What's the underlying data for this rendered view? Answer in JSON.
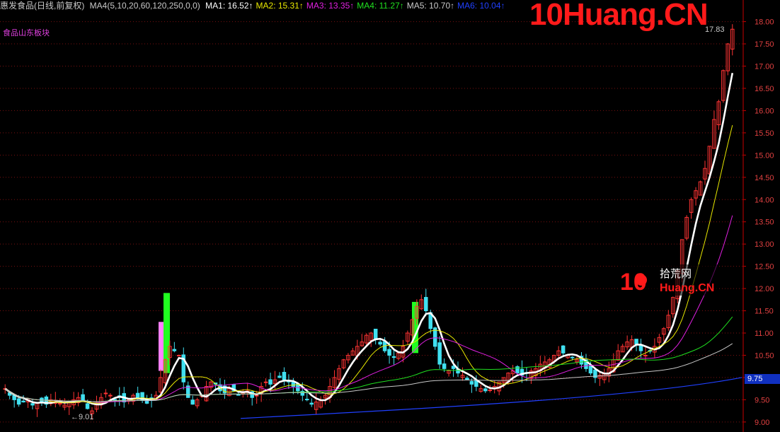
{
  "header": {
    "stock": "惠发食品(日线,前复权)",
    "indicator": "MA4(5,10,20,60,120,250,0,0)",
    "mas": [
      {
        "label": "MA1: 16.52↑",
        "color": "#ffffff"
      },
      {
        "label": "MA2: 15.31↑",
        "color": "#e8e800"
      },
      {
        "label": "MA3: 13.35↑",
        "color": "#e020e0"
      },
      {
        "label": "MA4: 11.27↑",
        "color": "#20e020"
      },
      {
        "label": "MA5: 10.70↑",
        "color": "#c8c8c8"
      },
      {
        "label": "MA6: 10.04↑",
        "color": "#2040ff"
      }
    ]
  },
  "sector_label": "食品山东板块",
  "watermark": {
    "main": "10Huang.CN",
    "logo_num": "10",
    "logo_cn": "拾荒网",
    "logo_sub": "Huang.CN"
  },
  "low_label": "←9.01",
  "high_label": "17.83",
  "current_price": "9.75",
  "colors": {
    "up": "#ff3333",
    "down": "#40e0f0",
    "grid": "#7a1010",
    "axis": "#c80000",
    "ma1": "#ffffff",
    "ma2": "#e8e800",
    "ma3": "#e020e0",
    "ma4": "#20e020",
    "ma5": "#c8c8c8",
    "ma6": "#2040ff",
    "vol_green": "#20ff20",
    "vol_pink": "#ff80ff"
  },
  "chart_data": {
    "type": "candlestick",
    "ylim": [
      8.95,
      18.2
    ],
    "yticks": [
      9.0,
      9.5,
      10.0,
      10.5,
      11.0,
      11.5,
      12.0,
      12.5,
      13.0,
      13.5,
      14.0,
      14.5,
      15.0,
      15.5,
      16.0,
      16.5,
      17.0,
      17.5,
      18.0
    ],
    "ytick_labels": [
      "9.00",
      "9.50",
      "10.00",
      "10.50",
      "11.00",
      "11.50",
      "12.00",
      "12.50",
      "13.00",
      "13.50",
      "14.00",
      "14.50",
      "15.00",
      "15.50",
      "16.00",
      "16.50",
      "17.00",
      "17.50",
      "18.00"
    ],
    "closes": [
      9.75,
      9.6,
      9.5,
      9.4,
      9.45,
      9.5,
      9.38,
      9.42,
      9.45,
      9.4,
      9.5,
      9.48,
      9.42,
      9.38,
      9.45,
      9.5,
      9.55,
      9.48,
      9.3,
      9.25,
      9.4,
      9.55,
      9.65,
      9.6,
      9.5,
      9.55,
      9.45,
      9.5,
      9.6,
      9.55,
      9.5,
      9.42,
      9.5,
      9.6,
      10.0,
      10.4,
      10.7,
      10.6,
      10.5,
      9.9,
      9.55,
      9.4,
      9.5,
      9.6,
      9.8,
      9.9,
      9.85,
      9.7,
      9.65,
      9.75,
      9.7,
      9.6,
      9.65,
      9.7,
      9.55,
      9.6,
      9.8,
      9.9,
      9.85,
      9.95,
      10.0,
      9.95,
      9.9,
      9.8,
      9.7,
      9.6,
      9.5,
      9.4,
      9.45,
      9.5,
      9.6,
      9.8,
      10.0,
      10.2,
      10.4,
      10.5,
      10.6,
      10.7,
      10.8,
      10.95,
      11.0,
      10.85,
      10.75,
      10.6,
      10.5,
      10.45,
      10.55,
      10.7,
      11.0,
      11.3,
      11.6,
      11.75,
      11.5,
      11.1,
      10.7,
      10.3,
      10.2,
      10.15,
      10.2,
      10.1,
      10.05,
      9.95,
      9.85,
      9.8,
      9.75,
      9.7,
      9.72,
      9.8,
      9.9,
      10.0,
      10.1,
      10.15,
      10.1,
      10.05,
      10.1,
      10.15,
      10.2,
      10.3,
      10.35,
      10.4,
      10.5,
      10.6,
      10.55,
      10.5,
      10.45,
      10.4,
      10.3,
      10.2,
      10.1,
      10.0,
      10.05,
      10.1,
      10.2,
      10.4,
      10.6,
      10.7,
      10.8,
      10.85,
      10.75,
      10.6,
      10.5,
      10.6,
      10.7,
      10.9,
      11.1,
      11.4,
      11.8,
      12.4,
      13.1,
      13.6,
      14.0,
      14.2,
      14.4,
      14.7,
      15.2,
      15.8,
      16.2,
      16.9,
      17.5,
      17.83
    ],
    "ma_last": {
      "MA1": 16.52,
      "MA2": 15.31,
      "MA3": 13.35,
      "MA4": 11.27,
      "MA5": 10.7,
      "MA6": 10.04
    },
    "low": 9.01,
    "high": 17.83
  }
}
